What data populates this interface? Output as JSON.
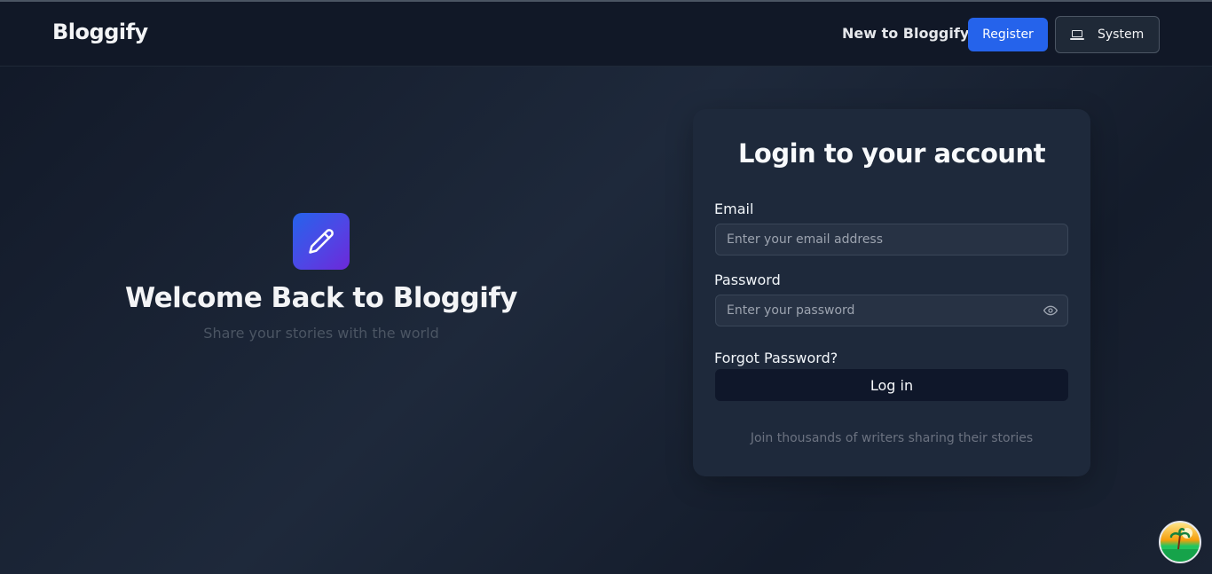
{
  "header": {
    "logo": "Bloggify",
    "new_to_text": "New to Bloggify?",
    "register_label": "Register",
    "system_label": "System",
    "system_icon": "laptop-icon"
  },
  "hero": {
    "icon": "pencil-icon",
    "title": "Welcome Back to Bloggify",
    "subtitle": "Share your stories with the world"
  },
  "login": {
    "title": "Login to your account",
    "email_label": "Email",
    "email_placeholder": "Enter your email address",
    "email_value": "",
    "password_label": "Password",
    "password_placeholder": "Enter your password",
    "password_value": "",
    "password_toggle_icon": "eye-icon",
    "forgot_label": "Forgot Password?",
    "submit_label": "Log in",
    "footer_text": "Join thousands of writers sharing their stories"
  },
  "colors": {
    "accent": "#2563eb",
    "hero_gradient_end": "#6d28d9",
    "card_bg": "#1e293b",
    "button_dark": "#0f172a"
  }
}
